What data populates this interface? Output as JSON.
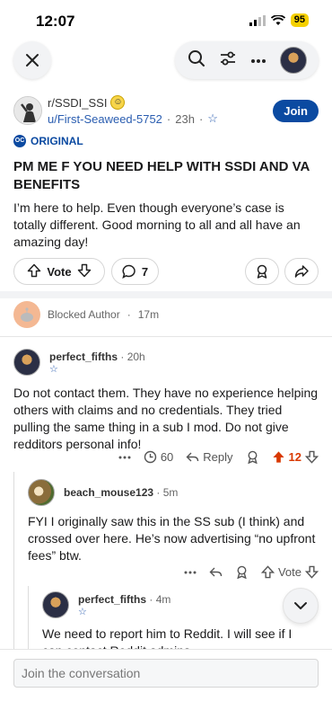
{
  "status_bar": {
    "time": "12:07",
    "battery": "95"
  },
  "post": {
    "subreddit": "r/SSDI_SSI",
    "author": "u/First-Seaweed-5752",
    "age": "23h",
    "join_label": "Join",
    "flair": "ORIGINAL",
    "oc_badge": "OC",
    "title": "PM ME F YOU NEED HELP WITH SSDI AND VA BENEFITS",
    "body": "I’m here to help. Even though everyone’s case is totally different. Good morning to all and all have an amazing day!",
    "vote_label": "Vote",
    "comment_count": "7"
  },
  "blocked": {
    "label": "Blocked Author",
    "age": "17m"
  },
  "comments": [
    {
      "user": "perfect_fifths",
      "age": "20h",
      "body": "Do not contact them. They have no experience helping others with claims and no credentials. They tried pulling the same thing in a sub I mod. Do not give redditors personal info!",
      "views": "60",
      "reply_label": "Reply",
      "score": "12"
    },
    {
      "user": "beach_mouse123",
      "age": "5m",
      "body": "FYI I originally saw this in the SS sub (I think) and crossed over here. He’s now advertising “no upfront fees” btw.",
      "vote_label": "Vote"
    },
    {
      "user": "perfect_fifths",
      "age": "4m",
      "body": "We need to report him to Reddit. I will see if I can contact Reddit admins"
    }
  ],
  "composer": {
    "placeholder": "Join the conversation"
  },
  "colors": {
    "accent": "#0b4aa1",
    "upvote": "#d93900",
    "link": "#2a5db0"
  }
}
